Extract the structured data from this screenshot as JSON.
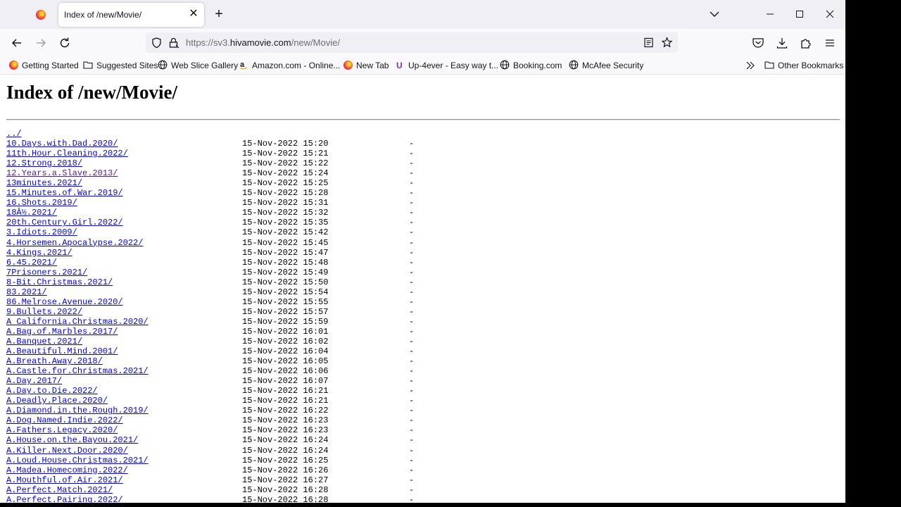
{
  "browser": {
    "tab_title": "Index of /new/Movie/",
    "tab_close": "✕",
    "new_tab": "+",
    "url_prefix": "https://sv3.",
    "url_host": "hivamovie.com",
    "url_path": "/new/Movie/",
    "bookmarks": [
      {
        "label": "Getting Started",
        "icon": "firefox-icon"
      },
      {
        "label": "Suggested Sites",
        "icon": "folder-icon"
      },
      {
        "label": "Web Slice Gallery",
        "icon": "globe-icon"
      },
      {
        "label": "Amazon.com - Online...",
        "icon": "amazon-icon"
      },
      {
        "label": "New Tab",
        "icon": "firefox-icon"
      },
      {
        "label": "Up-4ever - Easy way t...",
        "icon": "u-icon"
      },
      {
        "label": "Booking.com",
        "icon": "globe-icon"
      },
      {
        "label": "McAfee Security",
        "icon": "globe-icon"
      }
    ],
    "other_bookmarks": "Other Bookmarks"
  },
  "page": {
    "title": "Index of /new/Movie/",
    "parent_link": "../",
    "entries": [
      {
        "name": "10.Days.with.Dad.2020/",
        "date": "15-Nov-2022 15:20",
        "size": "-"
      },
      {
        "name": "11th.Hour.Cleaning.2022/",
        "date": "15-Nov-2022 15:21",
        "size": "-"
      },
      {
        "name": "12.Strong.2018/",
        "date": "15-Nov-2022 15:22",
        "size": "-"
      },
      {
        "name": "12.Years.a.Slave.2013/",
        "date": "15-Nov-2022 15:24",
        "size": "-",
        "visited": true
      },
      {
        "name": "13minutes.2021/",
        "date": "15-Nov-2022 15:25",
        "size": "-"
      },
      {
        "name": "15.Minutes.of.War.2019/",
        "date": "15-Nov-2022 15:28",
        "size": "-"
      },
      {
        "name": "16.Shots.2019/",
        "date": "15-Nov-2022 15:31",
        "size": "-"
      },
      {
        "name": "18Â½.2021/",
        "date": "15-Nov-2022 15:32",
        "size": "-"
      },
      {
        "name": "20th.Century.Girl.2022/",
        "date": "15-Nov-2022 15:35",
        "size": "-"
      },
      {
        "name": "3.Idiots.2009/",
        "date": "15-Nov-2022 15:42",
        "size": "-"
      },
      {
        "name": "4.Horsemen.Apocalypse.2022/",
        "date": "15-Nov-2022 15:45",
        "size": "-"
      },
      {
        "name": "4.Kings.2021/",
        "date": "15-Nov-2022 15:47",
        "size": "-"
      },
      {
        "name": "6.45.2021/",
        "date": "15-Nov-2022 15:48",
        "size": "-"
      },
      {
        "name": "7Prisoners.2021/",
        "date": "15-Nov-2022 15:49",
        "size": "-"
      },
      {
        "name": "8-Bit.Christmas.2021/",
        "date": "15-Nov-2022 15:50",
        "size": "-"
      },
      {
        "name": "83.2021/",
        "date": "15-Nov-2022 15:54",
        "size": "-"
      },
      {
        "name": "86.Melrose.Avenue.2020/",
        "date": "15-Nov-2022 15:55",
        "size": "-"
      },
      {
        "name": "9.Bullets.2022/",
        "date": "15-Nov-2022 15:57",
        "size": "-"
      },
      {
        "name": "A California.Christmas.2020/",
        "date": "15-Nov-2022 15:59",
        "size": "-"
      },
      {
        "name": "A.Bag.of.Marbles.2017/",
        "date": "15-Nov-2022 16:01",
        "size": "-"
      },
      {
        "name": "A.Banquet.2021/",
        "date": "15-Nov-2022 16:02",
        "size": "-"
      },
      {
        "name": "A.Beautiful.Mind.2001/",
        "date": "15-Nov-2022 16:04",
        "size": "-"
      },
      {
        "name": "A.Breath.Away.2018/",
        "date": "15-Nov-2022 16:05",
        "size": "-"
      },
      {
        "name": "A.Castle.for.Christmas.2021/",
        "date": "15-Nov-2022 16:06",
        "size": "-"
      },
      {
        "name": "A.Day.2017/",
        "date": "15-Nov-2022 16:07",
        "size": "-"
      },
      {
        "name": "A.Day.to.Die.2022/",
        "date": "15-Nov-2022 16:21",
        "size": "-"
      },
      {
        "name": "A.Deadly.Place.2020/",
        "date": "15-Nov-2022 16:21",
        "size": "-"
      },
      {
        "name": "A.Diamond.in.the.Rough.2019/",
        "date": "15-Nov-2022 16:22",
        "size": "-"
      },
      {
        "name": "A.Dog.Named.Indie.2022/",
        "date": "15-Nov-2022 16:23",
        "size": "-"
      },
      {
        "name": "A.Fathers.Legacy.2020/",
        "date": "15-Nov-2022 16:23",
        "size": "-"
      },
      {
        "name": "A.House.on.the.Bayou.2021/",
        "date": "15-Nov-2022 16:24",
        "size": "-"
      },
      {
        "name": "A.Killer.Next.Door.2020/",
        "date": "15-Nov-2022 16:24",
        "size": "-"
      },
      {
        "name": "A.Loud.House.Christmas.2021/",
        "date": "15-Nov-2022 16:25",
        "size": "-"
      },
      {
        "name": "A.Madea.Homecoming.2022/",
        "date": "15-Nov-2022 16:26",
        "size": "-"
      },
      {
        "name": "A.Mouthful.of.Air.2021/",
        "date": "15-Nov-2022 16:27",
        "size": "-"
      },
      {
        "name": "A.Perfect.Match.2021/",
        "date": "15-Nov-2022 16:28",
        "size": "-"
      },
      {
        "name": "A.Perfect.Pairing.2022/",
        "date": "15-Nov-2022 16:28",
        "size": "-"
      }
    ]
  }
}
